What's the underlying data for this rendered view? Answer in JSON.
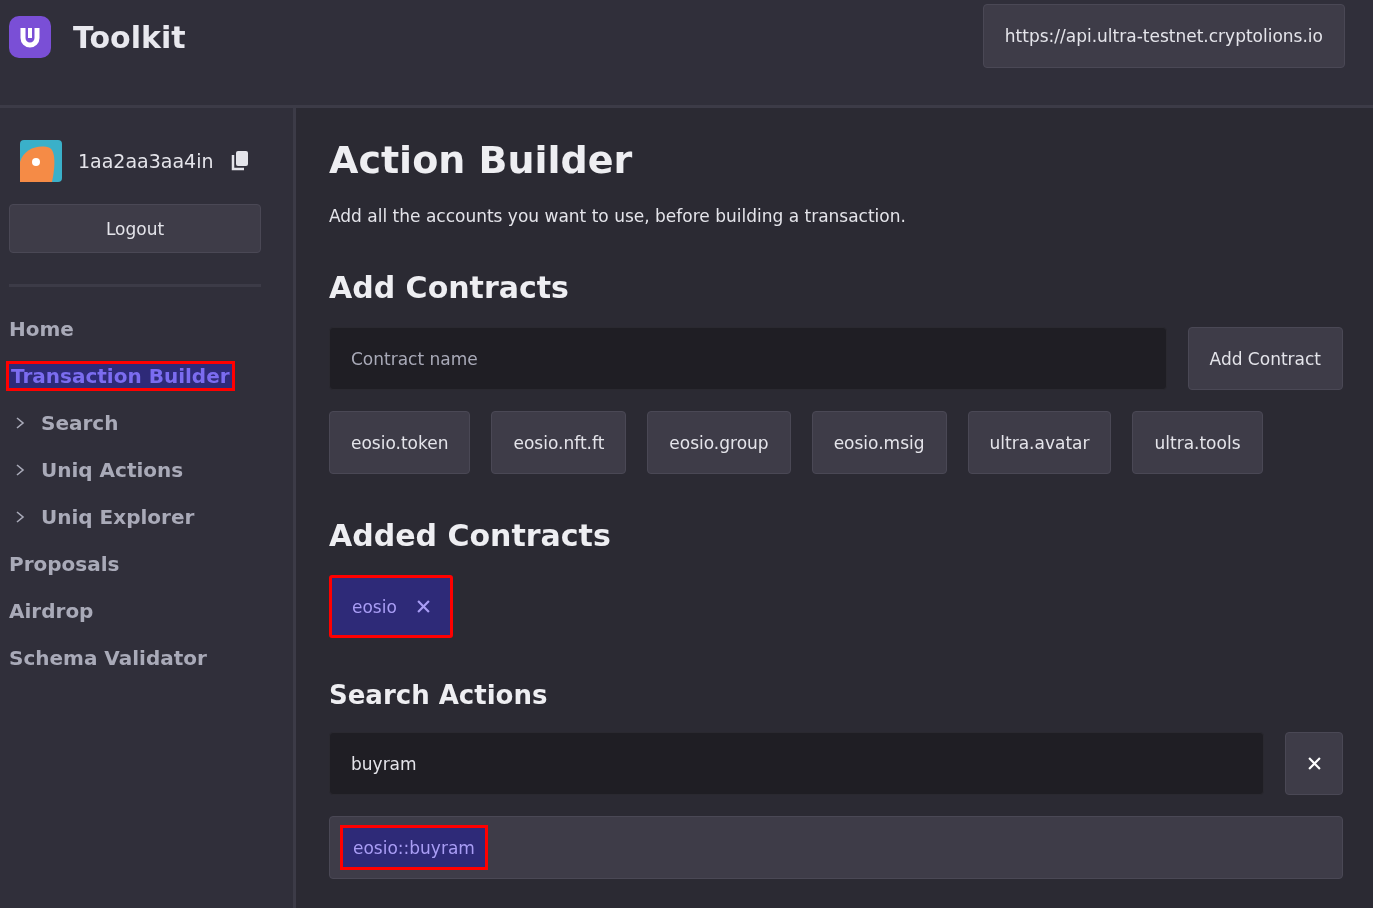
{
  "header": {
    "title": "Toolkit",
    "endpoint": "https://api.ultra-testnet.cryptolions.io"
  },
  "account": {
    "name": "1aa2aa3aa4in",
    "logout": "Logout"
  },
  "nav": [
    {
      "label": "Home",
      "kind": "link",
      "selected": false
    },
    {
      "label": "Transaction Builder",
      "kind": "link",
      "selected": true
    },
    {
      "label": "Search",
      "kind": "group",
      "selected": false
    },
    {
      "label": "Uniq Actions",
      "kind": "group",
      "selected": false
    },
    {
      "label": "Uniq Explorer",
      "kind": "group",
      "selected": false
    },
    {
      "label": "Proposals",
      "kind": "link",
      "selected": false
    },
    {
      "label": "Airdrop",
      "kind": "link",
      "selected": false
    },
    {
      "label": "Schema Validator",
      "kind": "link",
      "selected": false
    }
  ],
  "page": {
    "title": "Action Builder",
    "description": "Add all the accounts you want to use, before building a transaction."
  },
  "add_contracts": {
    "title": "Add Contracts",
    "placeholder": "Contract name",
    "button": "Add Contract",
    "suggestions": [
      "eosio.token",
      "eosio.nft.ft",
      "eosio.group",
      "eosio.msig",
      "ultra.avatar",
      "ultra.tools"
    ]
  },
  "added_contracts": {
    "title": "Added Contracts",
    "items": [
      {
        "label": "eosio",
        "selected": true
      }
    ]
  },
  "search_actions": {
    "title": "Search Actions",
    "value": "buyram",
    "results": [
      {
        "label": "eosio::buyram",
        "selected": true
      }
    ]
  }
}
